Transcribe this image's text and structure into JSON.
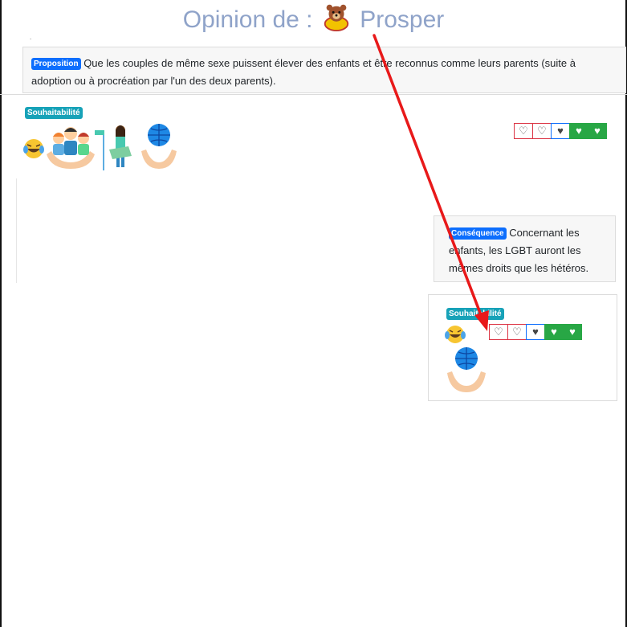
{
  "header": {
    "title_prefix": "Opinion de :",
    "user_name": "Prosper"
  },
  "proposition": {
    "badge": "Proposition",
    "text": "Que les couples de même sexe puissent élever des enfants et être reconnus comme leurs parents (suite à adoption ou à procréation par l'un des deux parents)."
  },
  "desirability_1": {
    "badge": "Souhaitabilité",
    "icons": [
      "laughing-crying-emoji",
      "hands-holding-family-icon",
      "woman-at-signpost-icon",
      "hands-holding-globe-icon"
    ],
    "rating": [
      "♡",
      "♡",
      "♥",
      "♥",
      "♥"
    ]
  },
  "consequence": {
    "badge": "Conséquence",
    "text": "Concernant les enfants, les LGBT auront les mêmes droits que les hétéros."
  },
  "desirability_2": {
    "badge": "Souhaitabilité",
    "icons": [
      "laughing-crying-emoji",
      "hands-holding-globe-icon"
    ],
    "rating": [
      "♡",
      "♡",
      "♥",
      "♥",
      "♥"
    ]
  },
  "colors": {
    "title": "#8fa3c9",
    "proposition_badge": "#0d6efd",
    "desirability_badge": "#17a2b8",
    "rating_negative": "#dc3545",
    "rating_neutral": "#0d6efd",
    "rating_positive": "#28a745",
    "annotation_arrow": "#e8191a"
  }
}
